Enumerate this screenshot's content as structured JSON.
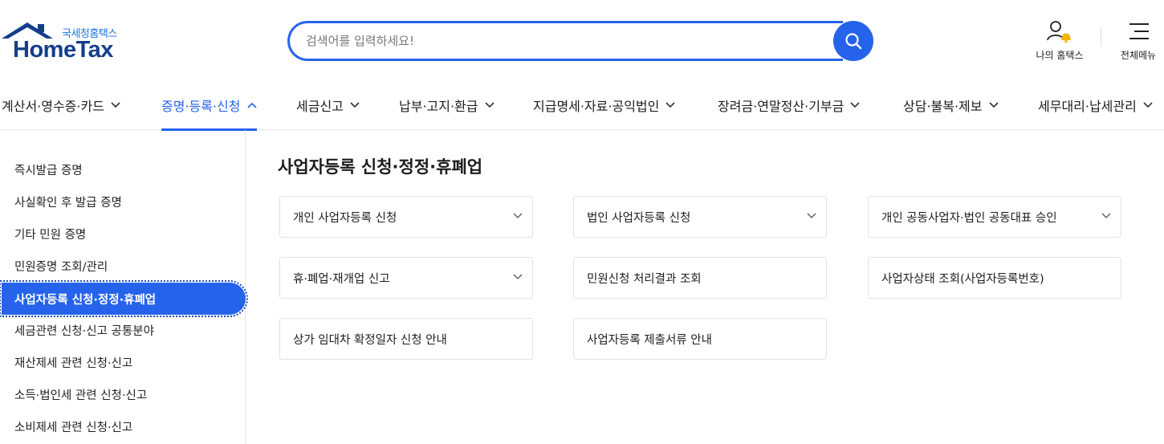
{
  "header": {
    "logo_sub": "국세청홈택스",
    "logo_main": "HomeTax",
    "search_placeholder": "검색어를 입력하세요!",
    "my_hometax_label": "나의 홈택스",
    "all_menu_label": "전체메뉴"
  },
  "nav": {
    "items": [
      {
        "label": "계산서·영수증·카드"
      },
      {
        "label": "증명·등록·신청"
      },
      {
        "label": "세금신고"
      },
      {
        "label": "납부·고지·환급"
      },
      {
        "label": "지급명세·자료·공익법인"
      },
      {
        "label": "장려금·연말정산·기부금"
      },
      {
        "label": "상담·불복·제보"
      },
      {
        "label": "세무대리·납세관리"
      }
    ],
    "active_index": 1
  },
  "sidebar": {
    "items": [
      {
        "label": "즉시발급 증명"
      },
      {
        "label": "사실확인 후 발급 증명"
      },
      {
        "label": "기타 민원 증명"
      },
      {
        "label": "민원증명 조회/관리"
      },
      {
        "label": "사업자등록 신청·정정·휴폐업"
      },
      {
        "label": "세금관련 신청·신고 공통분야"
      },
      {
        "label": "재산제세 관련 신청·신고"
      },
      {
        "label": "소득·법인세 관련 신청·신고"
      },
      {
        "label": "소비제세 관련 신청·신고"
      }
    ],
    "active_index": 4
  },
  "main": {
    "title": "사업자등록 신청·정정·휴폐업",
    "cards": [
      {
        "label": "개인 사업자등록 신청",
        "expandable": true
      },
      {
        "label": "법인 사업자등록 신청",
        "expandable": true
      },
      {
        "label": "개인 공동사업자·법인 공동대표 승인",
        "expandable": true
      },
      {
        "label": "휴·폐업·재개업 신고",
        "expandable": true
      },
      {
        "label": "민원신청 처리결과 조회",
        "expandable": false
      },
      {
        "label": "사업자상태 조회(사업자등록번호)",
        "expandable": false
      },
      {
        "label": "상가 임대차 확정일자 신청 안내",
        "expandable": false
      },
      {
        "label": "사업자등록 제출서류 안내",
        "expandable": false
      }
    ]
  },
  "colors": {
    "accent": "#2563eb",
    "logo_navy": "#143e8a",
    "bell": "#f5b400"
  }
}
